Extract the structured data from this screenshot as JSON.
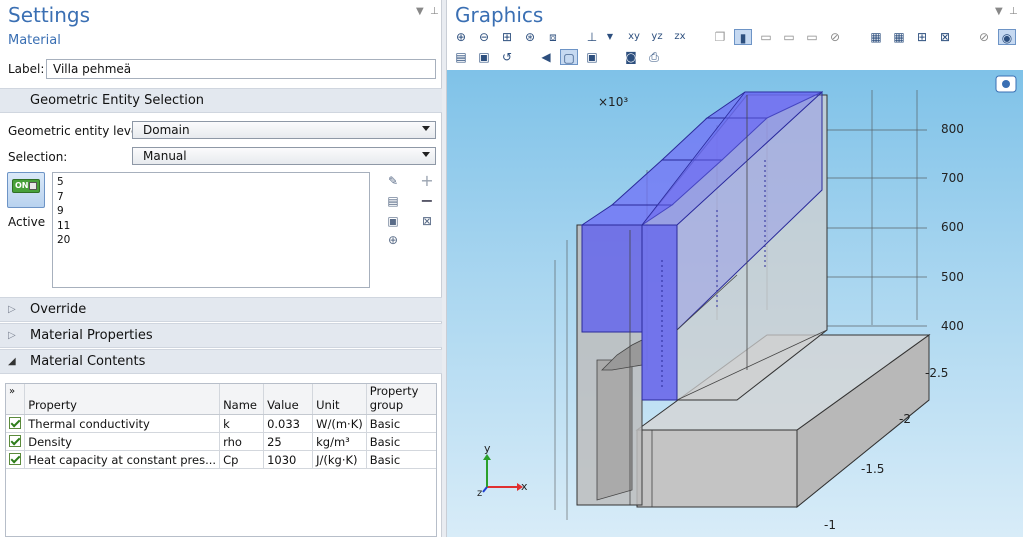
{
  "settings": {
    "title": "Settings",
    "subtitle": "Material",
    "label_caption": "Label:",
    "label_value": "Villa pehmeä",
    "geo_section": "Geometric Entity Selection",
    "entity_level_caption": "Geometric entity level:",
    "entity_level_value": "Domain",
    "selection_caption": "Selection:",
    "selection_value": "Manual",
    "active_toggle_text": "ON",
    "active_caption": "Active",
    "selection_items": [
      "5",
      "7",
      "9",
      "11",
      "20"
    ],
    "sections": {
      "override": "Override",
      "material_properties": "Material Properties",
      "material_contents": "Material Contents"
    },
    "table": {
      "headers": [
        "»",
        "Property",
        "Name",
        "Value",
        "Unit",
        "Property group"
      ],
      "rows": [
        {
          "property": "Thermal conductivity",
          "name": "k",
          "value": "0.033",
          "unit": "W/(m·K)",
          "group": "Basic"
        },
        {
          "property": "Density",
          "name": "rho",
          "value": "25",
          "unit": "kg/m³",
          "group": "Basic"
        },
        {
          "property": "Heat capacity at constant pres...",
          "name": "Cp",
          "value": "1030",
          "unit": "J/(kg·K)",
          "group": "Basic"
        }
      ]
    }
  },
  "graphics": {
    "title": "Graphics",
    "scale_label": "×10³",
    "z_ticks": [
      "800",
      "700",
      "600",
      "500",
      "400"
    ],
    "y_ticks": [
      "-2.5",
      "-2",
      "-1.5",
      "-1"
    ],
    "axis_x": "x",
    "axis_y": "y",
    "axis_z": "z",
    "colors": {
      "selected": "#5a5af0",
      "background_top": "#7fc2e8",
      "title": "#3a6fb3"
    }
  }
}
